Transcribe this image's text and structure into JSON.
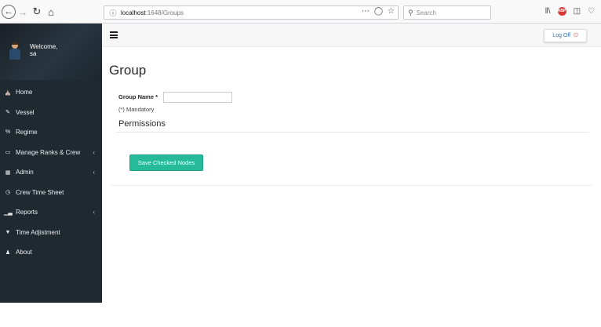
{
  "browser": {
    "url_host": "localhost",
    "url_path": ":1648/Groups",
    "search_placeholder": "Search",
    "adblock_label": "ABP"
  },
  "sidebar": {
    "welcome": "Welcome,",
    "username": "sa",
    "items": [
      {
        "label": "Home",
        "icon": "home-icon",
        "has_caret": false
      },
      {
        "label": "Vessel",
        "icon": "edit-icon",
        "has_caret": false
      },
      {
        "label": "Regime",
        "icon": "percent-icon",
        "has_caret": false
      },
      {
        "label": "Manage Ranks & Crew",
        "icon": "desktop-icon",
        "has_caret": true
      },
      {
        "label": "Admin",
        "icon": "table-icon",
        "has_caret": true
      },
      {
        "label": "Crew Time Sheet",
        "icon": "clock-icon",
        "has_caret": false
      },
      {
        "label": "Reports",
        "icon": "bar-chart-icon",
        "has_caret": true
      },
      {
        "label": "Time Adjistment",
        "icon": "filter-icon",
        "has_caret": false
      },
      {
        "label": "About",
        "icon": "user-icon",
        "has_caret": false
      }
    ]
  },
  "header": {
    "logoff_label": "Log Off"
  },
  "main": {
    "title": "Group",
    "group_name_label": "Group Name *",
    "group_name_value": "",
    "mandatory_note": "(*) Mandatory",
    "permissions_heading": "Permissions",
    "save_button_label": "Save Checked Nodes"
  },
  "colors": {
    "sidebar_bg": "#1f2a30",
    "accent_green": "#26b99a",
    "logoff_text": "#2d6fb4"
  }
}
